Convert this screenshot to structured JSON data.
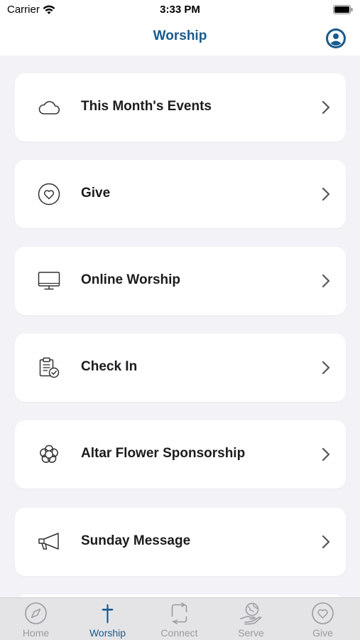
{
  "status_bar": {
    "carrier": "Carrier",
    "time": "3:33 PM"
  },
  "nav": {
    "title": "Worship"
  },
  "menu": {
    "items": [
      {
        "label": "This Month's Events",
        "icon": "cloud-icon"
      },
      {
        "label": "Give",
        "icon": "heart-icon"
      },
      {
        "label": "Online Worship",
        "icon": "monitor-icon"
      },
      {
        "label": "Check In",
        "icon": "clipboard-check-icon"
      },
      {
        "label": "Altar Flower Sponsorship",
        "icon": "flower-icon"
      },
      {
        "label": "Sunday Message",
        "icon": "megaphone-icon"
      }
    ]
  },
  "tabs": [
    {
      "label": "Home",
      "icon": "compass-icon",
      "active": false
    },
    {
      "label": "Worship",
      "icon": "cross-icon",
      "active": true
    },
    {
      "label": "Connect",
      "icon": "repeat-icon",
      "active": false
    },
    {
      "label": "Serve",
      "icon": "hand-globe-icon",
      "active": false
    },
    {
      "label": "Give",
      "icon": "heart-circle-icon",
      "active": false
    }
  ],
  "colors": {
    "accent": "#1a5a8c",
    "background": "#f2f2f7",
    "card": "#ffffff",
    "tab_inactive": "#9a9aa0"
  }
}
